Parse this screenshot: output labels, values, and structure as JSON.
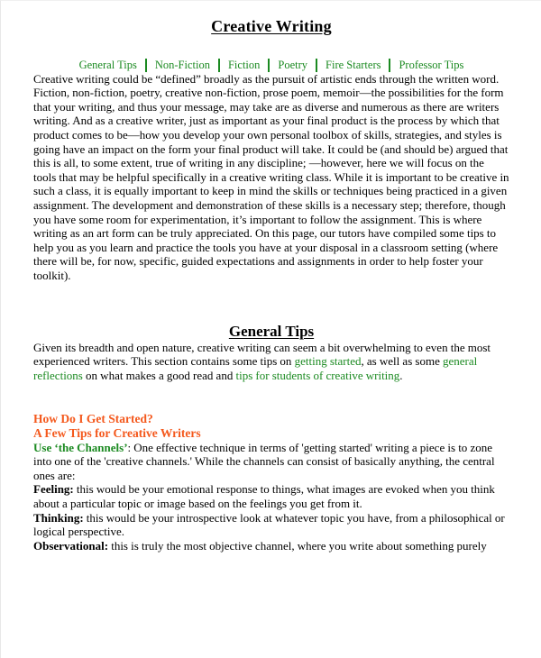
{
  "document": {
    "title": "Creative Writing",
    "nav": {
      "items": [
        {
          "label": "General Tips"
        },
        {
          "label": "Non-Fiction"
        },
        {
          "label": "Fiction"
        },
        {
          "label": "Poetry"
        },
        {
          "label": "Fire Starters"
        },
        {
          "label": "Professor Tips"
        }
      ]
    },
    "intro_paragraph": "Creative writing could be “defined” broadly as the pursuit of artistic ends through the written word.  Fiction, non-fiction, poetry, creative non-fiction, prose poem, memoir—the possibilities for the form that your writing, and thus your message, may take are as diverse and numerous as there are writers writing. And as a creative writer, just as important as your final product is the process by which that product comes to be—how you develop your own personal toolbox of skills, strategies, and styles is going have an impact on the form your final product will take. It could be (and should be) argued that this is all, to some extent, true of writing in any discipline; —however, here we will focus on the tools that may be helpful specifically in a creative writing class. While it is important to be creative in such a class, it is equally important to keep in mind the skills or techniques being practiced in a given assignment. The development and demonstration of these skills is a necessary step; therefore, though you have some room for experimentation, it’s important to follow the assignment. This is where writing as an art form can be truly appreciated.  On this page, our tutors have compiled some tips to help you as you learn and practice the tools you have at your disposal in a classroom setting (where there will be, for now, specific, guided expectations and assignments in order to help foster your toolkit).",
    "general_tips": {
      "heading": "General Tips",
      "paragraph_part1": "Given its breadth and open nature, creative writing can seem a bit overwhelming to even the most experienced writers.  This section contains some tips on ",
      "link1": "getting started",
      "paragraph_part2": ", as well as some ",
      "link2": "general reflections",
      "paragraph_part3": " on what makes a good read and ",
      "link3": "tips for students of creative writing",
      "paragraph_part4": "."
    },
    "subheadings": {
      "line1": "How Do I Get Started?",
      "line2": "A Few Tips for Creative Writers"
    },
    "channels": {
      "lead": "Use ‘the Channels’",
      "text": ": One effective technique in terms of 'getting started' writing a piece is to zone into one of the 'creative channels.' While the channels can consist of basically anything, the central ones are:"
    },
    "items": [
      {
        "lead": "Feeling:",
        "text": " this would be your emotional response to things, what images are evoked when you think about a particular topic or image based on the feelings you get from it."
      },
      {
        "lead": "Thinking:",
        "text": " this would be your introspective look at whatever topic you have, from a philosophical or logical perspective."
      },
      {
        "lead": "Observational:",
        "text": " this is truly the most objective channel, where you write about something purely"
      }
    ],
    "colors": {
      "link_green": "#1b8a21",
      "subheading_orange": "#f4581c",
      "text_black": "#000000",
      "page_background": "#ffffff"
    }
  }
}
